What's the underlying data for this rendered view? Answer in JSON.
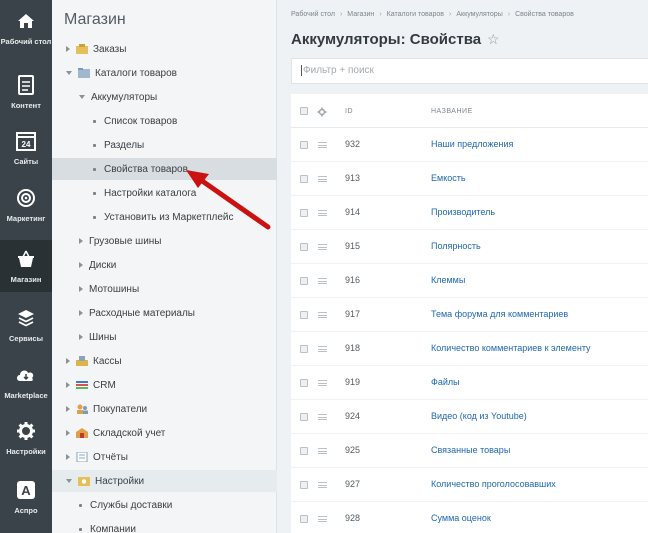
{
  "sidebar": {
    "items": [
      {
        "label": "Рабочий стол",
        "icon": "home-icon"
      },
      {
        "label": "Контент",
        "icon": "document-icon"
      },
      {
        "label": "Сайты",
        "icon": "calendar-icon"
      },
      {
        "label": "Маркетинг",
        "icon": "target-icon"
      },
      {
        "label": "Магазин",
        "icon": "basket-icon",
        "active": true
      },
      {
        "label": "Сервисы",
        "icon": "layers-icon"
      },
      {
        "label": "Marketplace",
        "icon": "cloud-download-icon"
      },
      {
        "label": "Настройки",
        "icon": "gear-icon"
      },
      {
        "label": "Аспро",
        "icon": "letter-a-icon"
      }
    ]
  },
  "tree": {
    "title": "Магазин",
    "nodes": [
      {
        "label": "Заказы"
      },
      {
        "label": "Каталоги товаров"
      },
      {
        "label": "Аккумуляторы"
      },
      {
        "label": "Список товаров"
      },
      {
        "label": "Разделы"
      },
      {
        "label": "Свойства товаров"
      },
      {
        "label": "Настройки каталога"
      },
      {
        "label": "Установить из Маркетплейс"
      },
      {
        "label": "Грузовые шины"
      },
      {
        "label": "Диски"
      },
      {
        "label": "Мотошины"
      },
      {
        "label": "Расходные материалы"
      },
      {
        "label": "Шины"
      },
      {
        "label": "Кассы"
      },
      {
        "label": "CRM"
      },
      {
        "label": "Покупатели"
      },
      {
        "label": "Складской учет"
      },
      {
        "label": "Отчёты"
      },
      {
        "label": "Настройки"
      },
      {
        "label": "Службы доставки"
      },
      {
        "label": "Компании"
      }
    ]
  },
  "breadcrumb": [
    "Рабочий стол",
    "Магазин",
    "Каталоги товаров",
    "Аккумуляторы",
    "Свойства товаров"
  ],
  "page": {
    "title": "Аккумуляторы: Свойства",
    "filter_placeholder": "Фильтр + поиск"
  },
  "table": {
    "columns": {
      "id": "ID",
      "name": "НАЗВАНИЕ"
    },
    "rows": [
      {
        "id": "932",
        "name": "Наши предложения"
      },
      {
        "id": "913",
        "name": "Емкость"
      },
      {
        "id": "914",
        "name": "Производитель"
      },
      {
        "id": "915",
        "name": "Полярность"
      },
      {
        "id": "916",
        "name": "Клеммы"
      },
      {
        "id": "917",
        "name": "Тема форума для комментариев"
      },
      {
        "id": "918",
        "name": "Количество комментариев к элементу"
      },
      {
        "id": "919",
        "name": "Файлы"
      },
      {
        "id": "924",
        "name": "Видео (код из Youtube)"
      },
      {
        "id": "925",
        "name": "Связанные товары"
      },
      {
        "id": "927",
        "name": "Количество проголосовавших"
      },
      {
        "id": "928",
        "name": "Сумма оценок"
      }
    ]
  },
  "colors": {
    "rail": "#3a4349",
    "link": "#2067b0",
    "arrow": "#cc1111"
  }
}
